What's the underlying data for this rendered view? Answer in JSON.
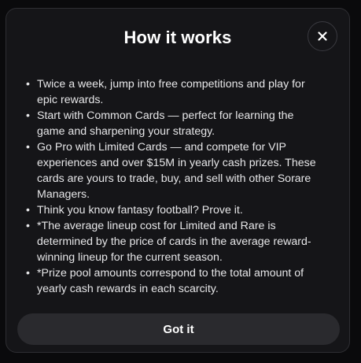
{
  "modal": {
    "title": "How it works",
    "close_icon": "close-icon",
    "items": [
      "Twice a week, jump into free competitions and play for epic rewards.",
      "Start with Common Cards — perfect for learning the game and sharpening your strategy.",
      "Go Pro with Limited Cards — and compete for VIP experiences and over $15M in yearly cash prizes. These cards are yours to trade, buy, and sell with other Sorare Managers.",
      "Think you know fantasy football? Prove it.",
      "*The average lineup cost for Limited and Rare is determined by the price of cards in the average reward-winning lineup for the current season.",
      "*Prize pool amounts correspond to the total amount of yearly cash rewards in each scarcity."
    ],
    "bullet": "•",
    "button_label": "Got it"
  },
  "colors": {
    "background": "#0b0b0d",
    "modal_bg": "#151518",
    "button_bg": "#2a2a2e",
    "text": "#e6e6e8",
    "title": "#ffffff"
  }
}
